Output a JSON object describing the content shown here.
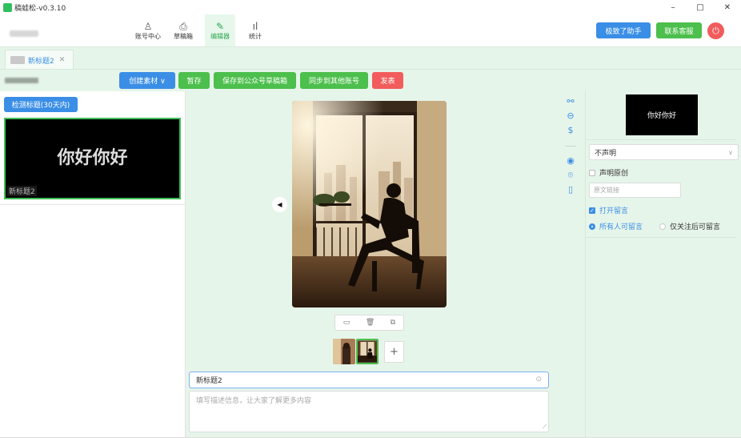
{
  "app": {
    "title": "稿蛙松-v0.3.10"
  },
  "window_controls": {
    "minimize": "–",
    "maximize": "□",
    "close": "✕"
  },
  "nav": {
    "items": [
      {
        "label": "账号中心",
        "icon": "person-icon"
      },
      {
        "label": "草稿箱",
        "icon": "printer-icon"
      },
      {
        "label": "编辑器",
        "icon": "pen-icon"
      },
      {
        "label": "统计",
        "icon": "bar-chart-icon"
      }
    ],
    "active": "编辑器",
    "assistant_button": "极致了助手",
    "service_button": "联系客服"
  },
  "tabs": [
    {
      "label": "新标题2"
    }
  ],
  "toolbar": {
    "create_material": "创建素材 ∨",
    "temp_save": "暂存",
    "save_draft": "保存到公众号草稿箱",
    "sync_accounts": "同步到其他账号",
    "publish": "发表"
  },
  "left": {
    "detect_button": "检测标题(30天内)",
    "card": {
      "big_text": "你好你好",
      "label": "新标题2"
    }
  },
  "center": {
    "image_tools": [
      "▭",
      "🗑",
      "⧉"
    ],
    "add_image": "+",
    "title_value": "新标题2",
    "description_placeholder": "填写描述信息，让大家了解更多内容"
  },
  "right": {
    "cover_text": "你好你好",
    "declare_select": "不声明",
    "declare_original": "声明原创",
    "original_link_placeholder": "原文链接",
    "open_comment": "打开留言",
    "comment_all": "所有人可留言",
    "comment_followers": "仅关注后可留言"
  },
  "colors": {
    "accent_green": "#4cbf4c",
    "accent_blue": "#3a8ee6",
    "danger_red": "#f25c5c",
    "bg_mint": "#e6f5ea"
  }
}
